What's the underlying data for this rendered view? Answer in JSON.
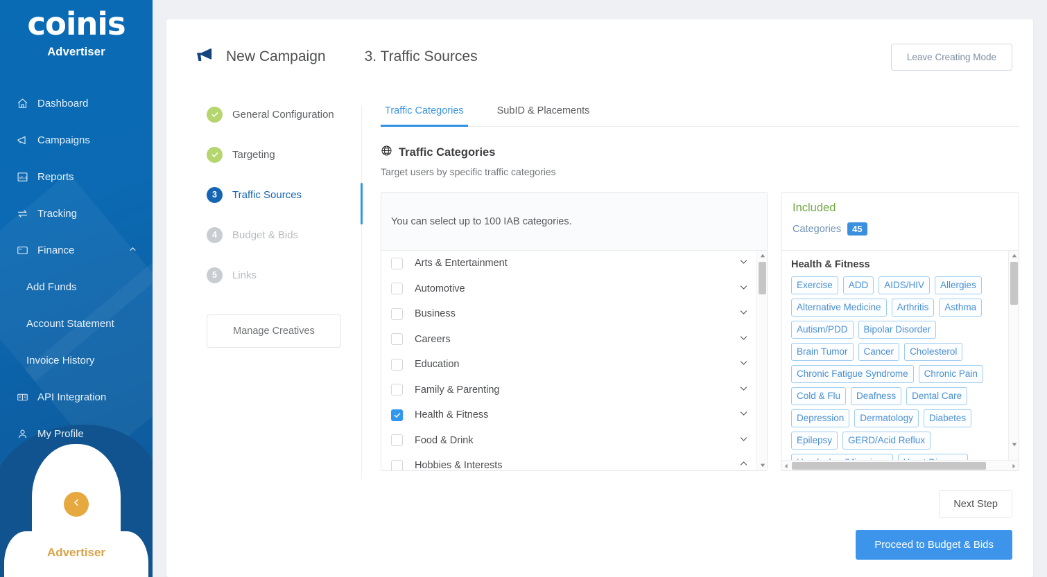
{
  "brand": {
    "logo_text": "coinis",
    "logo_subtitle": "Advertiser",
    "footer_label": "Advertiser",
    "accent_gold": "#d9a247",
    "sidebar_blue": "#0b6ab3",
    "primary_blue": "#3d95eb"
  },
  "sidebar": {
    "items": [
      {
        "label": "Dashboard",
        "icon": "home-icon"
      },
      {
        "label": "Campaigns",
        "icon": "megaphone-icon"
      },
      {
        "label": "Reports",
        "icon": "bar-chart-icon"
      },
      {
        "label": "Tracking",
        "icon": "exchange-icon"
      },
      {
        "label": "Finance",
        "icon": "credit-card-icon",
        "expanded": true,
        "chevron": "chevron-up-icon"
      }
    ],
    "finance_children": [
      {
        "label": "Add Funds"
      },
      {
        "label": "Account Statement"
      },
      {
        "label": "Invoice History"
      }
    ],
    "items_after": [
      {
        "label": "API Integration",
        "icon": "book-icon"
      },
      {
        "label": "My Profile",
        "icon": "user-icon"
      }
    ],
    "collapse_icon": "chevron-left-icon"
  },
  "header": {
    "campaign_icon": "megaphone-icon",
    "campaign_title": "New Campaign",
    "step_title": "3. Traffic Sources",
    "leave_button": "Leave Creating Mode"
  },
  "steps": [
    {
      "badge": "check",
      "label": "General Configuration",
      "state": "done"
    },
    {
      "badge": "check",
      "label": "Targeting",
      "state": "done"
    },
    {
      "badge": "3",
      "label": "Traffic Sources",
      "state": "current"
    },
    {
      "badge": "4",
      "label": "Budget & Bids",
      "state": "todo"
    },
    {
      "badge": "5",
      "label": "Links",
      "state": "todo"
    }
  ],
  "manage_creatives_button": "Manage Creatives",
  "tabs": [
    {
      "label": "Traffic Categories",
      "active": true
    },
    {
      "label": "SubID & Placements",
      "active": false
    }
  ],
  "section": {
    "icon": "globe-icon",
    "title": "Traffic Categories",
    "subtitle": "Target users by specific traffic categories"
  },
  "category_panel": {
    "notice": "You can select up to 100 IAB categories.",
    "rows": [
      {
        "label": "Arts & Entertainment",
        "checked": false,
        "chevron": "chevron-down-icon"
      },
      {
        "label": "Automotive",
        "checked": false,
        "chevron": "chevron-down-icon"
      },
      {
        "label": "Business",
        "checked": false,
        "chevron": "chevron-down-icon"
      },
      {
        "label": "Careers",
        "checked": false,
        "chevron": "chevron-down-icon"
      },
      {
        "label": "Education",
        "checked": false,
        "chevron": "chevron-down-icon"
      },
      {
        "label": "Family & Parenting",
        "checked": false,
        "chevron": "chevron-down-icon"
      },
      {
        "label": "Health & Fitness",
        "checked": true,
        "chevron": "chevron-down-icon"
      },
      {
        "label": "Food & Drink",
        "checked": false,
        "chevron": "chevron-down-icon"
      },
      {
        "label": "Hobbies & Interests",
        "checked": false,
        "chevron": "chevron-up-icon"
      }
    ]
  },
  "included_panel": {
    "title": "Included",
    "count_label": "Categories",
    "count_value": "45",
    "group_title": "Health & Fitness",
    "chips": [
      "Exercise",
      "ADD",
      "AIDS/HIV",
      "Allergies",
      "Alternative Medicine",
      "Arthritis",
      "Asthma",
      "Autism/PDD",
      "Bipolar Disorder",
      "Brain Tumor",
      "Cancer",
      "Cholesterol",
      "Chronic Fatigue Syndrome",
      "Chronic Pain",
      "Cold & Flu",
      "Deafness",
      "Dental Care",
      "Depression",
      "Dermatology",
      "Diabetes",
      "Epilepsy",
      "GERD/Acid Reflux",
      "Headaches/Migraines",
      "Heart Disease"
    ]
  },
  "footer": {
    "next_step_button": "Next Step",
    "proceed_button": "Proceed to Budget & Bids"
  }
}
